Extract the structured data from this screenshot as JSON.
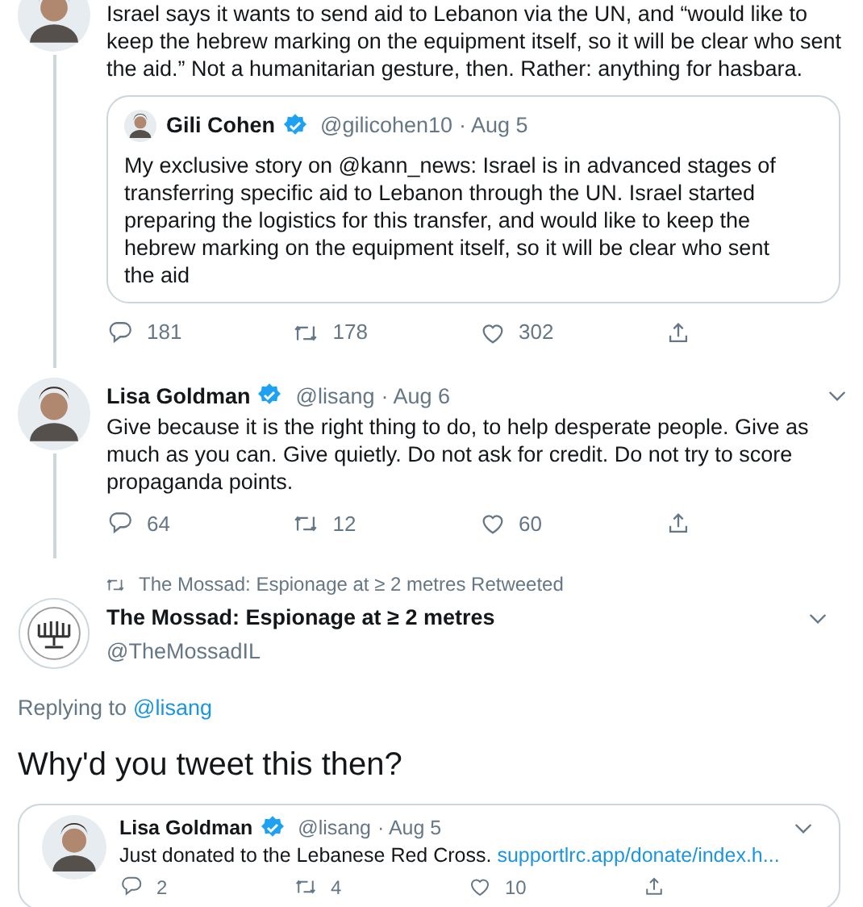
{
  "tweets": [
    {
      "kind": "tweet",
      "thread": true,
      "text": "Israel says it wants to send aid to Lebanon via the UN, and “would like to keep the hebrew marking on the equipment itself, so it will be clear who sent the aid.” Not a humanitarian gesture, then. Rather: anything for hasbara.",
      "quote": {
        "name": "Gili Cohen",
        "verified": true,
        "handle": "@gilicohen10",
        "date": "· Aug 5",
        "text": "My exclusive story on @kann_news: Israel is in advanced stages of transferring specific aid to Lebanon through the UN. Israel started preparing the logistics for this transfer, and would like to keep the hebrew marking on the equipment itself, so it will be clear who sent the aid"
      },
      "actions": [
        {
          "kind": "reply",
          "count": "181"
        },
        {
          "kind": "retweet",
          "count": "178"
        },
        {
          "kind": "like",
          "count": "302"
        },
        {
          "kind": "share"
        }
      ]
    },
    {
      "kind": "tweet",
      "menu": true,
      "thread": true,
      "name": "Lisa Goldman",
      "verified": true,
      "handle": "@lisang",
      "date": "· Aug 6",
      "text": "Give because it is the right thing to do, to help desperate people. Give as much as you can. Give quietly. Do not ask for credit. Do not try to score propaganda points.",
      "actions": [
        {
          "kind": "reply",
          "count": "64"
        },
        {
          "kind": "retweet",
          "count": "12"
        },
        {
          "kind": "like",
          "count": "60"
        },
        {
          "kind": "share"
        }
      ]
    },
    {
      "kind": "focused",
      "menu": true,
      "retweeted_by": "The Mossad: Espionage at ≥ 2 metres Retweeted",
      "name": "The Mossad: Espionage at ≥ 2 metres",
      "handle": "@TheMossadIL",
      "replying_label": "Replying to",
      "replying_to": "@lisang",
      "text": "Why'd you tweet this then?",
      "quote": {
        "name": "Lisa Goldman",
        "verified": true,
        "handle": "@lisang",
        "date": "· Aug 5",
        "menu": true,
        "text": "Just donated to the Lebanese Red Cross.",
        "link": "supportlrc.app/donate/index.h...",
        "actions": [
          {
            "kind": "reply",
            "count": "2"
          },
          {
            "kind": "retweet",
            "count": "4"
          },
          {
            "kind": "like",
            "count": "10"
          },
          {
            "kind": "share"
          }
        ]
      }
    }
  ]
}
